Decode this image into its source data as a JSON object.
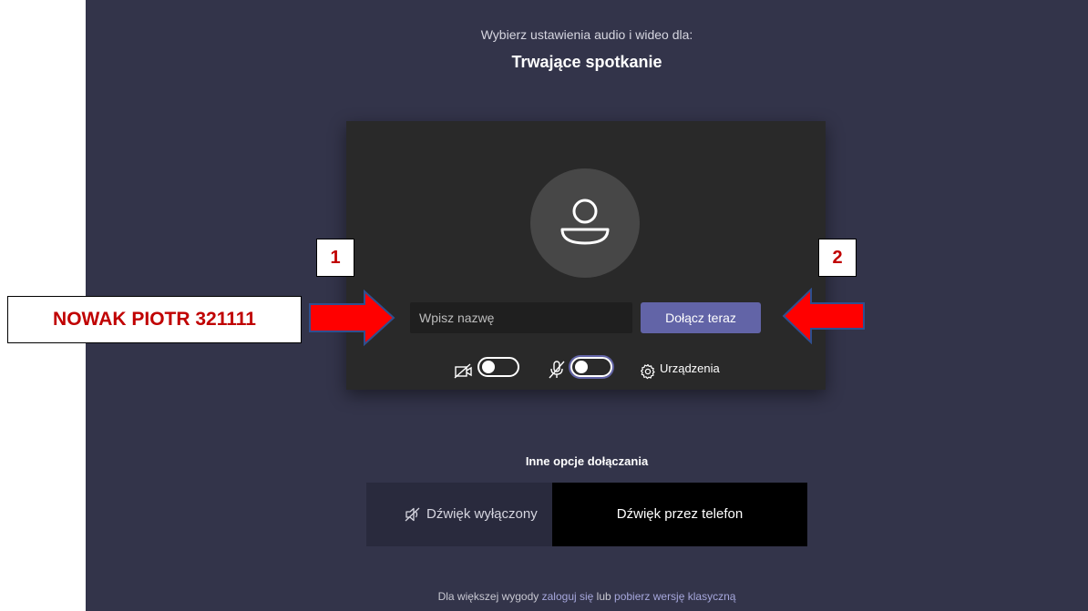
{
  "header": {
    "subtitle": "Wybierz ustawienia audio i wideo dla:",
    "meeting_title": "Trwające spotkanie"
  },
  "prejoin": {
    "name_placeholder": "Wpisz nazwę",
    "join_label": "Dołącz teraz",
    "camera_on": false,
    "mic_on": false,
    "devices_label": "Urządzenia"
  },
  "other_options": {
    "title": "Inne opcje dołączania",
    "audio_off_label": "Dźwięk wyłączony",
    "phone_audio_label": "Dźwięk przez telefon"
  },
  "footer": {
    "prefix": "Dla większej wygody",
    "signin_link": "zaloguj się",
    "middle": "lub",
    "download_link": "pobierz wersję klasyczną"
  },
  "annotations": {
    "badge_1": "1",
    "badge_2": "2",
    "name_example": "NOWAK PIOTR 321111",
    "color": "#c00000",
    "arrow_color": "#ff0000"
  },
  "colors": {
    "background": "#33344a",
    "card": "#292929",
    "accent": "#6264a7"
  }
}
